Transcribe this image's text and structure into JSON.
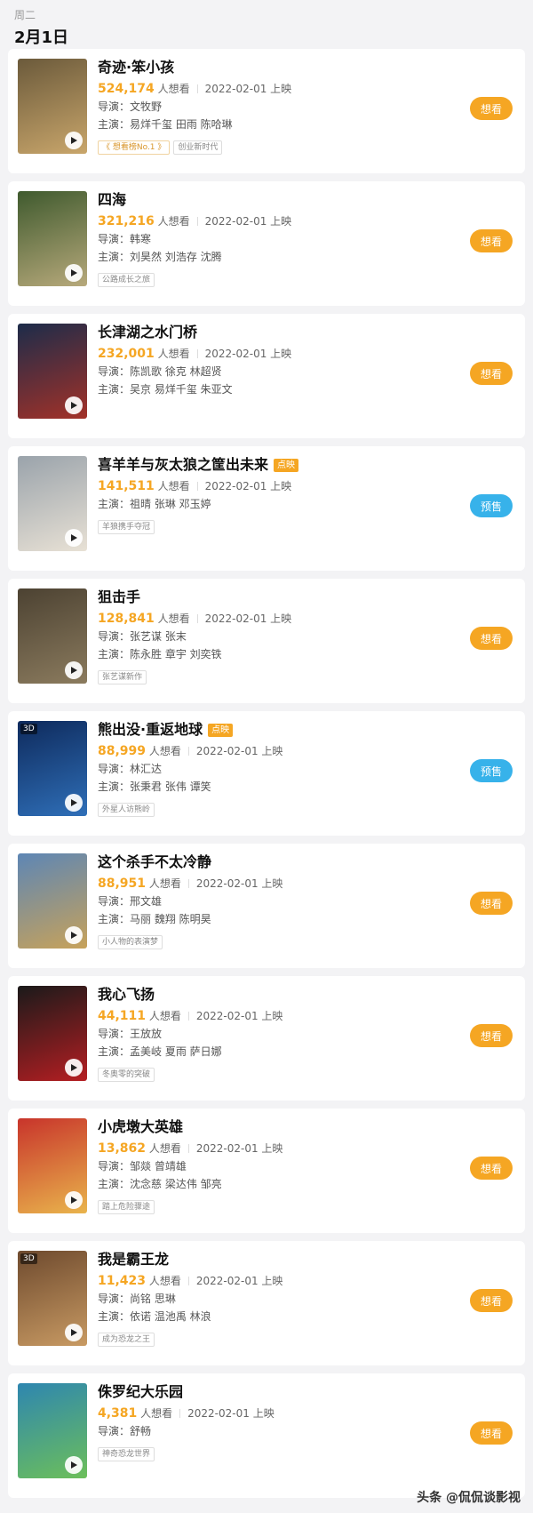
{
  "header": {
    "weekday": "周二",
    "date": "2月1日"
  },
  "labels": {
    "want_suffix": "人想看",
    "director": "导演：",
    "cast": "主演："
  },
  "movies": [
    {
      "title": "奇迹·笨小孩",
      "hot_tag": "",
      "want_count": "524,174",
      "release": "2022-02-01 上映",
      "director": "文牧野",
      "cast": "易烊千玺 田雨 陈哈琳",
      "has_3d": false,
      "chips": [
        "想看榜No.1",
        "创业新时代"
      ],
      "gold_first_chip": true,
      "button": "想看",
      "button_type": "want",
      "poster_colors": [
        "#6b5a3b",
        "#c9a66b"
      ]
    },
    {
      "title": "四海",
      "hot_tag": "",
      "want_count": "321,216",
      "release": "2022-02-01 上映",
      "director": "韩寒",
      "cast": "刘昊然 刘浩存 沈腾",
      "has_3d": false,
      "chips": [
        "公路成长之旅"
      ],
      "gold_first_chip": false,
      "button": "想看",
      "button_type": "want",
      "poster_colors": [
        "#3f5a2e",
        "#b7a97b"
      ]
    },
    {
      "title": "长津湖之水门桥",
      "hot_tag": "",
      "want_count": "232,001",
      "release": "2022-02-01 上映",
      "director": "陈凯歌 徐克 林超贤",
      "cast": "吴京 易烊千玺 朱亚文",
      "has_3d": false,
      "chips": [],
      "gold_first_chip": false,
      "button": "想看",
      "button_type": "want",
      "poster_colors": [
        "#1c2c4a",
        "#a33128"
      ]
    },
    {
      "title": "喜羊羊与灰太狼之筐出未来",
      "hot_tag": "点映",
      "want_count": "141,511",
      "release": "2022-02-01 上映",
      "director": "",
      "cast": "祖晴 张琳 邓玉婷",
      "has_3d": false,
      "chips": [
        "羊狼携手夺冠"
      ],
      "gold_first_chip": false,
      "button": "预售",
      "button_type": "presale",
      "poster_colors": [
        "#9aa3ab",
        "#e8e1d5"
      ]
    },
    {
      "title": "狙击手",
      "hot_tag": "",
      "want_count": "128,841",
      "release": "2022-02-01 上映",
      "director": "张艺谋 张末",
      "cast": "陈永胜 章宇 刘奕铁",
      "has_3d": false,
      "chips": [
        "张艺谋新作"
      ],
      "gold_first_chip": false,
      "button": "想看",
      "button_type": "want",
      "poster_colors": [
        "#4c4232",
        "#8b7b5e"
      ]
    },
    {
      "title": "熊出没·重返地球",
      "hot_tag": "点映",
      "want_count": "88,999",
      "release": "2022-02-01 上映",
      "director": "林汇达",
      "cast": "张秉君 张伟 谭笑",
      "has_3d": true,
      "chips": [
        "外星人访熊岭"
      ],
      "gold_first_chip": false,
      "button": "预售",
      "button_type": "presale",
      "poster_colors": [
        "#0e2a5c",
        "#2f6fb8"
      ]
    },
    {
      "title": "这个杀手不太冷静",
      "hot_tag": "",
      "want_count": "88,951",
      "release": "2022-02-01 上映",
      "director": "邢文雄",
      "cast": "马丽 魏翔 陈明昊",
      "has_3d": false,
      "chips": [
        "小人物的表演梦"
      ],
      "gold_first_chip": false,
      "button": "想看",
      "button_type": "want",
      "poster_colors": [
        "#5d86b5",
        "#c7a25a"
      ]
    },
    {
      "title": "我心飞扬",
      "hot_tag": "",
      "want_count": "44,111",
      "release": "2022-02-01 上映",
      "director": "王放放",
      "cast": "孟美岐 夏雨 萨日娜",
      "has_3d": false,
      "chips": [
        "冬奥零的突破"
      ],
      "gold_first_chip": false,
      "button": "想看",
      "button_type": "want",
      "poster_colors": [
        "#1a1a1a",
        "#b51e22"
      ]
    },
    {
      "title": "小虎墩大英雄",
      "hot_tag": "",
      "want_count": "13,862",
      "release": "2022-02-01 上映",
      "director": "邹燚 曾靖雄",
      "cast": "沈念慈 梁达伟 邹亮",
      "has_3d": false,
      "chips": [
        "踏上危险骤途"
      ],
      "gold_first_chip": false,
      "button": "想看",
      "button_type": "want",
      "poster_colors": [
        "#c8342b",
        "#e9b44c"
      ]
    },
    {
      "title": "我是霸王龙",
      "hot_tag": "",
      "want_count": "11,423",
      "release": "2022-02-01 上映",
      "director": "尚铭 思琳",
      "cast": "依诺 温池禹 林浪",
      "has_3d": true,
      "chips": [
        "成为恐龙之王"
      ],
      "gold_first_chip": false,
      "button": "想看",
      "button_type": "want",
      "poster_colors": [
        "#6e4a2e",
        "#c89a63"
      ]
    },
    {
      "title": "侏罗纪大乐园",
      "hot_tag": "",
      "want_count": "4,381",
      "release": "2022-02-01 上映",
      "director": "舒畅",
      "cast": "",
      "has_3d": false,
      "chips": [
        "神奇恐龙世界"
      ],
      "gold_first_chip": false,
      "button": "想看",
      "button_type": "want",
      "poster_colors": [
        "#2e86b0",
        "#6cbf5a"
      ]
    }
  ],
  "watermark": "头条 @侃侃谈影视"
}
